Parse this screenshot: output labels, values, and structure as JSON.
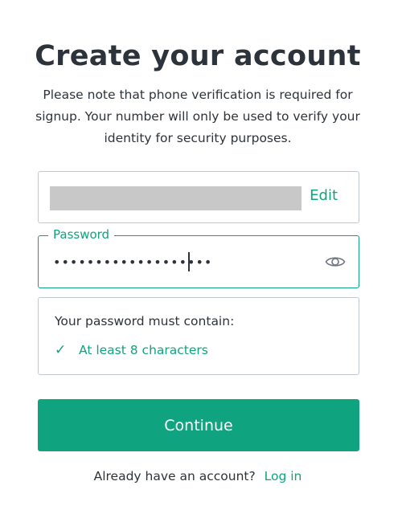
{
  "page": {
    "title": "Create your account",
    "subtitle": "Please note that phone verification is required for signup. Your number will only be used to verify your identity for security purposes."
  },
  "email_field": {
    "value": "",
    "edit_label": "Edit"
  },
  "password_field": {
    "label": "Password",
    "masked_value": "•••••••••••••••••••",
    "toggle_icon": "eye-icon"
  },
  "password_rules": {
    "heading": "Your password must contain:",
    "items": [
      {
        "check_glyph": "✓",
        "label": "At least 8 characters"
      }
    ]
  },
  "continue_button": {
    "label": "Continue"
  },
  "login_prompt": {
    "text": "Already have an account?",
    "link_label": "Log in"
  },
  "colors": {
    "accent": "#10a37f",
    "text": "#2d333a",
    "border": "#c2c8d0",
    "redacted": "#c8c8c8"
  }
}
